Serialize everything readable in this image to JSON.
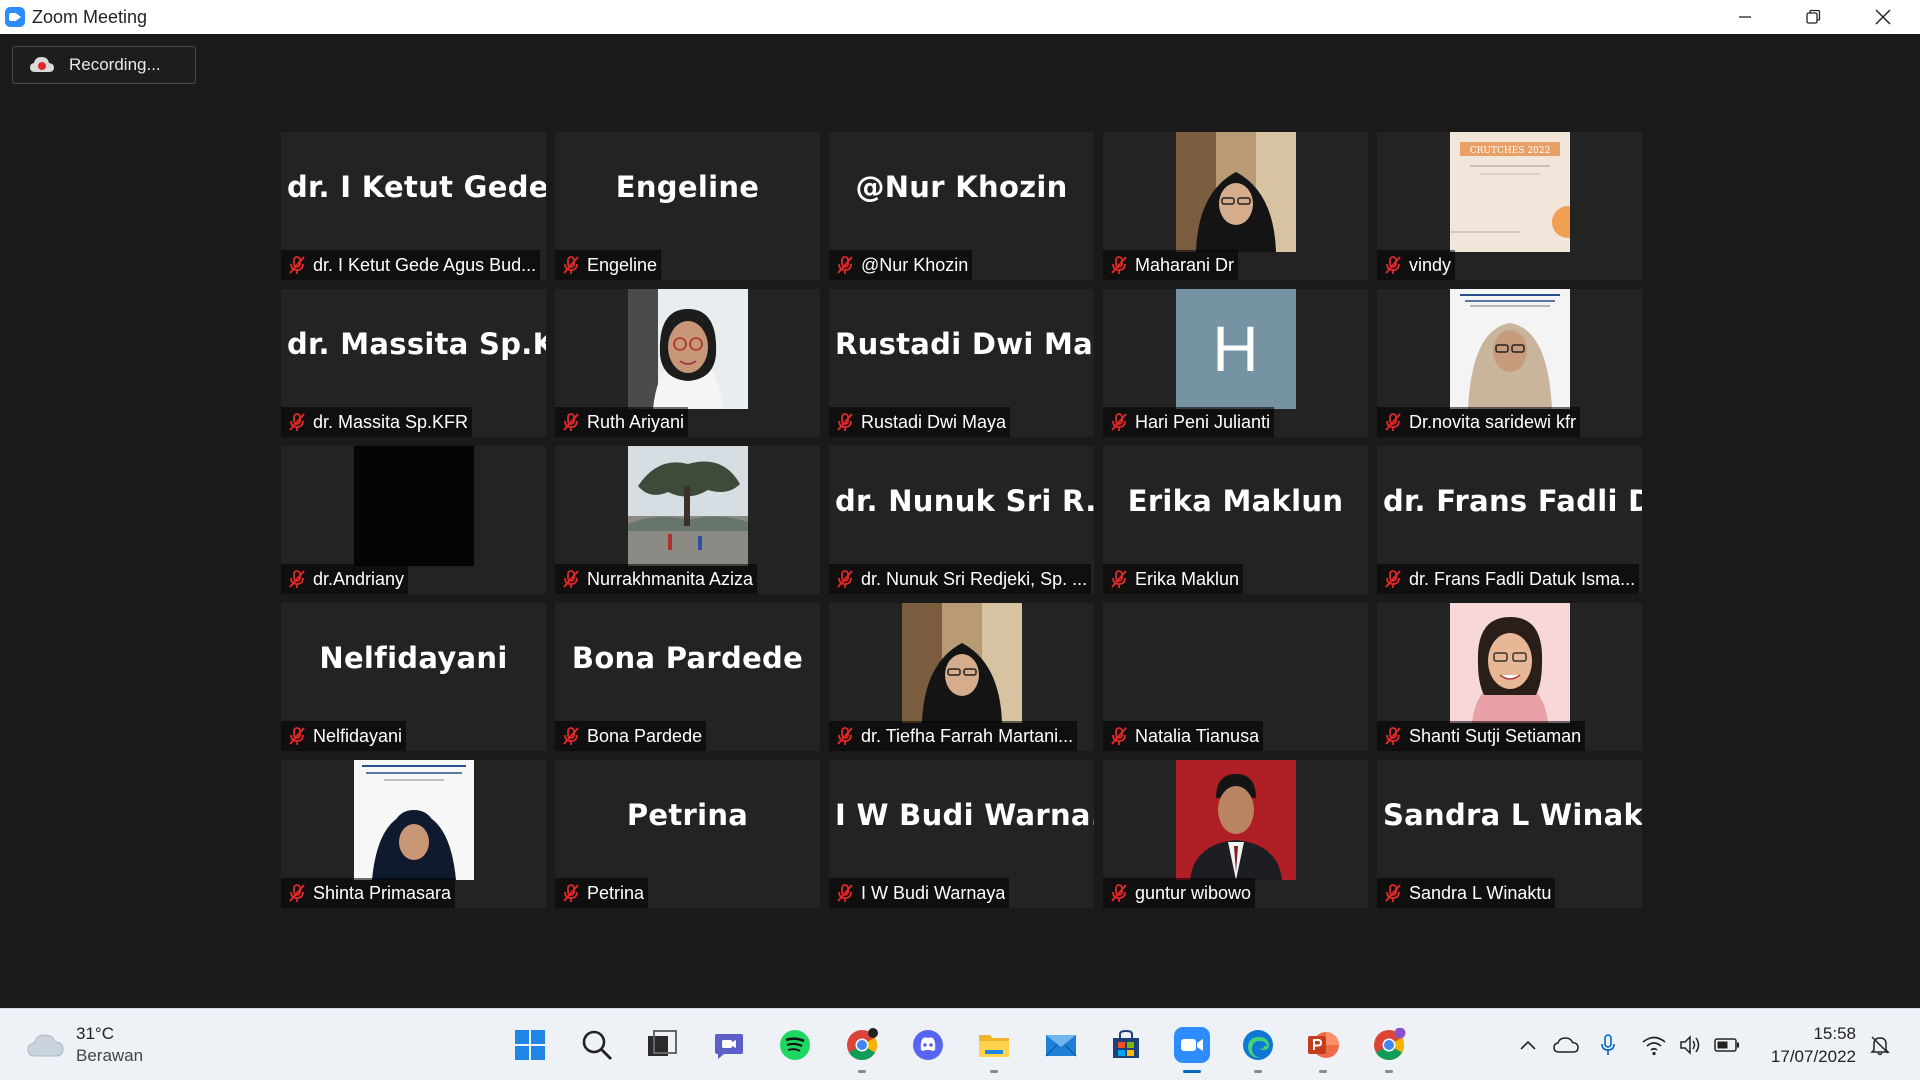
{
  "window": {
    "title": "Zoom Meeting"
  },
  "recording": {
    "label": "Recording..."
  },
  "participants": [
    {
      "display": "dr. I Ketut Gede...",
      "name": "dr. I Ketut Gede Agus Bud...",
      "video": ""
    },
    {
      "display": "Engeline",
      "name": "Engeline",
      "video": ""
    },
    {
      "display": "@Nur Khozin",
      "name": "@Nur Khozin",
      "video": ""
    },
    {
      "display": "",
      "name": "Maharani Dr",
      "video": "person-hijab-black"
    },
    {
      "display": "",
      "name": "vindy",
      "video": "slide-crutches"
    },
    {
      "display": "dr. Massita Sp.K...",
      "name": "dr. Massita Sp.KFR",
      "video": ""
    },
    {
      "display": "",
      "name": "Ruth Ariyani",
      "video": "person-glasses"
    },
    {
      "display": "Rustadi Dwi Ma...",
      "name": "Rustadi Dwi Maya",
      "video": ""
    },
    {
      "display": "",
      "name": "Hari Peni Julianti",
      "video": "avatar-h"
    },
    {
      "display": "",
      "name": "Dr.novita saridewi kfr",
      "video": "person-slide"
    },
    {
      "display": "",
      "name": "dr.Andriany",
      "video": "black"
    },
    {
      "display": "",
      "name": "Nurrakhmanita Aziza",
      "video": "landscape-tree"
    },
    {
      "display": "dr. Nunuk Sri R...",
      "name": "dr. Nunuk Sri Redjeki, Sp. ...",
      "video": ""
    },
    {
      "display": "Erika Maklun",
      "name": "Erika Maklun",
      "video": ""
    },
    {
      "display": "dr. Frans Fadli D...",
      "name": "dr. Frans Fadli Datuk Isma...",
      "video": ""
    },
    {
      "display": "Nelfidayani",
      "name": "Nelfidayani",
      "video": ""
    },
    {
      "display": "Bona Pardede",
      "name": "Bona Pardede",
      "video": ""
    },
    {
      "display": "",
      "name": "dr. Tiefha Farrah Martani...",
      "video": "person-hijab-black"
    },
    {
      "display": "",
      "name": "Natalia Tianusa",
      "video": ""
    },
    {
      "display": "",
      "name": "Shanti Sutji Setiaman",
      "video": "person-pink"
    },
    {
      "display": "",
      "name": "Shinta Primasara",
      "video": "person-slide2"
    },
    {
      "display": "Petrina",
      "name": "Petrina",
      "video": ""
    },
    {
      "display": "I W Budi Warna...",
      "name": "I W Budi Warnaya",
      "video": ""
    },
    {
      "display": "",
      "name": "guntur wibowo",
      "video": "person-red-bg"
    },
    {
      "display": "Sandra L Winaktu",
      "name": "Sandra L Winaktu",
      "video": ""
    }
  ],
  "slides": {
    "crutches_title": "CRUTCHES 2022",
    "h_avatar": "H"
  },
  "weather": {
    "temp": "31°C",
    "condition": "Berawan"
  },
  "taskbar_apps": [
    {
      "icon": "windows-start-icon",
      "active": false,
      "open": false
    },
    {
      "icon": "search-icon",
      "active": false,
      "open": false
    },
    {
      "icon": "task-view-icon",
      "active": false,
      "open": false
    },
    {
      "icon": "teams-chat-icon",
      "active": false,
      "open": false
    },
    {
      "icon": "spotify-icon",
      "active": false,
      "open": false
    },
    {
      "icon": "chrome-icon",
      "active": false,
      "open": true
    },
    {
      "icon": "discord-icon",
      "active": false,
      "open": false
    },
    {
      "icon": "file-explorer-icon",
      "active": false,
      "open": true
    },
    {
      "icon": "mail-icon",
      "active": false,
      "open": false
    },
    {
      "icon": "microsoft-store-icon",
      "active": false,
      "open": false
    },
    {
      "icon": "zoom-icon",
      "active": true,
      "open": true
    },
    {
      "icon": "edge-icon",
      "active": false,
      "open": true
    },
    {
      "icon": "powerpoint-icon",
      "active": false,
      "open": true
    },
    {
      "icon": "chrome-profile-icon",
      "active": false,
      "open": true
    }
  ],
  "clock": {
    "time": "15:58",
    "date": "17/07/2022"
  },
  "colors": {
    "mic_muted": "#e02828",
    "zoom_blue": "#2d8cff",
    "active_indicator": "#0067c0"
  }
}
